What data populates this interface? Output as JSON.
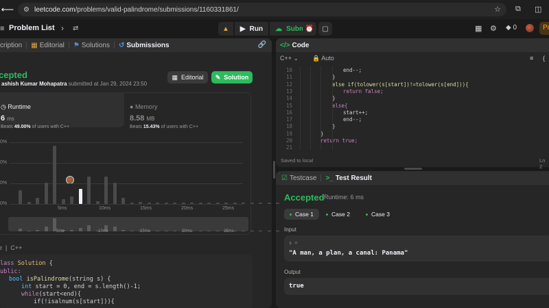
{
  "browser": {
    "url_host": "leetcode.com",
    "url_path": "/problems/valid-palindrome/submissions/1160331861/",
    "icons": [
      "tune-icon",
      "star-icon",
      "extensions-icon",
      "sidebar-icon"
    ]
  },
  "topbar": {
    "problem_list": "Problem List",
    "run": "Run",
    "submit": "Submit",
    "streak": "0",
    "premium": "Pr"
  },
  "left_tabs": [
    {
      "icon": "description-icon",
      "label": "cription"
    },
    {
      "icon": "editorial-icon",
      "label": "Editorial"
    },
    {
      "icon": "solutions-icon",
      "label": "Solutions"
    },
    {
      "icon": "submissions-icon",
      "label": "Submissions"
    }
  ],
  "submission": {
    "status": "cepted",
    "author": "ashish Kumar Mohapatra",
    "submitted_text": "submitted at Jan 29, 2024 23:50",
    "editorial_btn": "Editorial",
    "solution_btn": "Solution"
  },
  "runtime": {
    "title": "Runtime",
    "value": "6",
    "unit": "ms",
    "beats_prefix": "Beats",
    "beats_pct": "49.00%",
    "beats_suffix": "of users with C++"
  },
  "memory": {
    "title": "Memory",
    "value": "8.58",
    "unit": "MB",
    "beats_prefix": "Beats",
    "beats_pct": "15.43%",
    "beats_suffix": "of users with C++"
  },
  "chart_data": {
    "type": "bar",
    "y_ticks": [
      "0%",
      "0%",
      "0%",
      "0%"
    ],
    "x_ticks": [
      "5ms",
      "10ms",
      "15ms",
      "20ms",
      "25ms"
    ],
    "mini_ticks": [
      "5ms",
      "10ms",
      "15ms",
      "20ms",
      "25ms"
    ],
    "values": [
      0.22,
      0.03,
      0.1,
      0.35,
      0.95,
      0.08,
      0.12,
      0.25,
      0.45,
      0.05,
      0.45,
      0.35,
      0.1,
      0.02,
      0.03,
      0.02,
      0.02,
      0.02,
      0.02,
      0.02,
      0.02,
      0.02,
      0.02,
      0.02,
      0.02,
      0.02,
      0.02,
      0.02,
      0.02,
      0.02,
      0.02
    ],
    "highlight_index": 7
  },
  "lang_row": {
    "a": "e",
    "b": "C++"
  },
  "left_code": [
    {
      "t": "lass",
      "k": "kw",
      "rest": [
        " ",
        "Solution",
        " {"
      ]
    },
    {
      "t": "ublic:",
      "k": "kw",
      "rest": [
        "",
        "",
        ""
      ]
    }
  ],
  "left_code_text": {
    "l1a": "lass ",
    "l1b": "Solution",
    "l1c": " {",
    "l2": "ublic:",
    "l3a": "bool ",
    "l3b": "isPalindrome",
    "l3c": "(string s) {",
    "l4a": "int ",
    "l4b": "start = 0, end = s.length()-1;",
    "l5a": "while",
    "l5b": "(start<end){",
    "l6": "if(!isalnum(s[start])){"
  },
  "code_panel": {
    "title": "Code",
    "lang": "C++",
    "mode": "Auto",
    "saved": "Saved to local",
    "status": "Ln 2",
    "lines": [
      {
        "n": "10",
        "text": "end--;"
      },
      {
        "n": "11",
        "text": "}"
      },
      {
        "n": "12",
        "text": "else if(tolower(s[start])!=tolower(s[end])){"
      },
      {
        "n": "13",
        "text": "return false;"
      },
      {
        "n": "14",
        "text": "}"
      },
      {
        "n": "15",
        "text": "else{"
      },
      {
        "n": "16",
        "text": "start++;"
      },
      {
        "n": "17",
        "text": "end--;"
      },
      {
        "n": "18",
        "text": "}"
      },
      {
        "n": "19",
        "text": "}"
      },
      {
        "n": "20",
        "text": "return true;"
      },
      {
        "n": "21",
        "text": ""
      }
    ]
  },
  "test_panel": {
    "tab_testcase": "Testcase",
    "tab_result": "Test Result",
    "status": "Accepted",
    "runtime": "Runtime: 6 ms",
    "cases": [
      "Case 1",
      "Case 2",
      "Case 3"
    ],
    "input_label": "Input",
    "input_var": "s =",
    "input_value": "\"A man, a plan, a canal: Panama\"",
    "output_label": "Output",
    "output_value": "true"
  }
}
